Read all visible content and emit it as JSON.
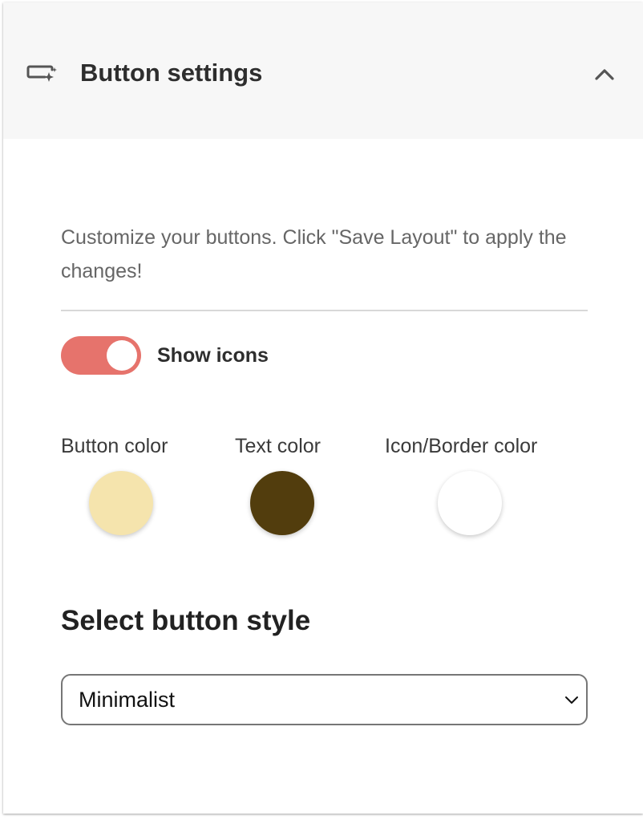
{
  "header": {
    "icon": "button-sparkle-icon",
    "title": "Button settings",
    "collapse_icon": "chevron-up-icon"
  },
  "body": {
    "description": "Customize your buttons. Click \"Save Layout\" to apply the changes!",
    "show_icons": {
      "label": "Show icons",
      "checked": true,
      "on_color": "#e6736c"
    },
    "colors": [
      {
        "label": "Button color",
        "value": "#f5e4ad"
      },
      {
        "label": "Text color",
        "value": "#523d0d"
      },
      {
        "label": "Icon/Border color",
        "value": "#ffffff"
      }
    ],
    "style_section": {
      "title": "Select button style",
      "selected": "Minimalist"
    }
  }
}
